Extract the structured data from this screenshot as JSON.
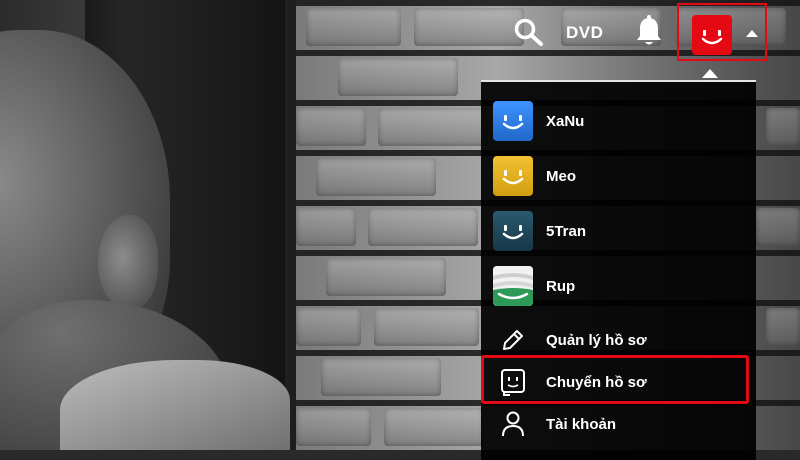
{
  "nav": {
    "search_icon": "search-icon",
    "dvd_label": "DVD",
    "notifications_icon": "bell-icon",
    "caret_icon": "caret-up-icon"
  },
  "profiles": [
    {
      "name": "XaNu",
      "color": "#2f80e8",
      "icon": "smiley-avatar"
    },
    {
      "name": "Meo",
      "color": "#e6b41e",
      "icon": "smiley-avatar"
    },
    {
      "name": "5Tran",
      "color": "#1f4a5e",
      "icon": "smiley-avatar"
    },
    {
      "name": "Rup",
      "color": "#2e9a58",
      "icon": "striped-avatar"
    }
  ],
  "actions": {
    "manage_profiles": "Quản lý hồ sơ",
    "switch_profile": "Chuyển hồ sơ",
    "account": "Tài khoản"
  },
  "colors": {
    "accent": "#e50914",
    "menu_bg": "#000000",
    "text": "#ffffff"
  }
}
